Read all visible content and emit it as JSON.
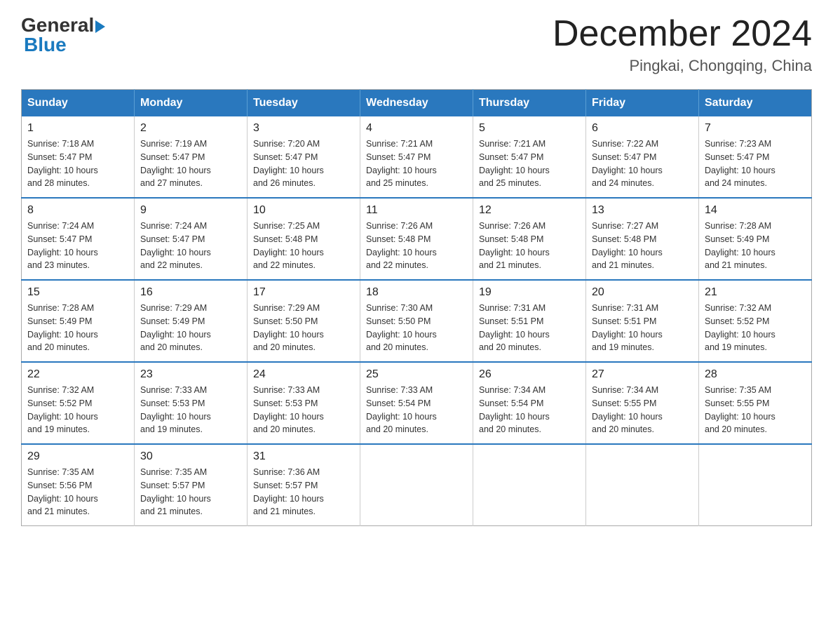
{
  "header": {
    "logo_general": "General",
    "logo_blue": "Blue",
    "title": "December 2024",
    "subtitle": "Pingkai, Chongqing, China"
  },
  "calendar": {
    "weekdays": [
      "Sunday",
      "Monday",
      "Tuesday",
      "Wednesday",
      "Thursday",
      "Friday",
      "Saturday"
    ],
    "weeks": [
      [
        {
          "day": "1",
          "sunrise": "7:18 AM",
          "sunset": "5:47 PM",
          "daylight": "10 hours and 28 minutes."
        },
        {
          "day": "2",
          "sunrise": "7:19 AM",
          "sunset": "5:47 PM",
          "daylight": "10 hours and 27 minutes."
        },
        {
          "day": "3",
          "sunrise": "7:20 AM",
          "sunset": "5:47 PM",
          "daylight": "10 hours and 26 minutes."
        },
        {
          "day": "4",
          "sunrise": "7:21 AM",
          "sunset": "5:47 PM",
          "daylight": "10 hours and 25 minutes."
        },
        {
          "day": "5",
          "sunrise": "7:21 AM",
          "sunset": "5:47 PM",
          "daylight": "10 hours and 25 minutes."
        },
        {
          "day": "6",
          "sunrise": "7:22 AM",
          "sunset": "5:47 PM",
          "daylight": "10 hours and 24 minutes."
        },
        {
          "day": "7",
          "sunrise": "7:23 AM",
          "sunset": "5:47 PM",
          "daylight": "10 hours and 24 minutes."
        }
      ],
      [
        {
          "day": "8",
          "sunrise": "7:24 AM",
          "sunset": "5:47 PM",
          "daylight": "10 hours and 23 minutes."
        },
        {
          "day": "9",
          "sunrise": "7:24 AM",
          "sunset": "5:47 PM",
          "daylight": "10 hours and 22 minutes."
        },
        {
          "day": "10",
          "sunrise": "7:25 AM",
          "sunset": "5:48 PM",
          "daylight": "10 hours and 22 minutes."
        },
        {
          "day": "11",
          "sunrise": "7:26 AM",
          "sunset": "5:48 PM",
          "daylight": "10 hours and 22 minutes."
        },
        {
          "day": "12",
          "sunrise": "7:26 AM",
          "sunset": "5:48 PM",
          "daylight": "10 hours and 21 minutes."
        },
        {
          "day": "13",
          "sunrise": "7:27 AM",
          "sunset": "5:48 PM",
          "daylight": "10 hours and 21 minutes."
        },
        {
          "day": "14",
          "sunrise": "7:28 AM",
          "sunset": "5:49 PM",
          "daylight": "10 hours and 21 minutes."
        }
      ],
      [
        {
          "day": "15",
          "sunrise": "7:28 AM",
          "sunset": "5:49 PM",
          "daylight": "10 hours and 20 minutes."
        },
        {
          "day": "16",
          "sunrise": "7:29 AM",
          "sunset": "5:49 PM",
          "daylight": "10 hours and 20 minutes."
        },
        {
          "day": "17",
          "sunrise": "7:29 AM",
          "sunset": "5:50 PM",
          "daylight": "10 hours and 20 minutes."
        },
        {
          "day": "18",
          "sunrise": "7:30 AM",
          "sunset": "5:50 PM",
          "daylight": "10 hours and 20 minutes."
        },
        {
          "day": "19",
          "sunrise": "7:31 AM",
          "sunset": "5:51 PM",
          "daylight": "10 hours and 20 minutes."
        },
        {
          "day": "20",
          "sunrise": "7:31 AM",
          "sunset": "5:51 PM",
          "daylight": "10 hours and 19 minutes."
        },
        {
          "day": "21",
          "sunrise": "7:32 AM",
          "sunset": "5:52 PM",
          "daylight": "10 hours and 19 minutes."
        }
      ],
      [
        {
          "day": "22",
          "sunrise": "7:32 AM",
          "sunset": "5:52 PM",
          "daylight": "10 hours and 19 minutes."
        },
        {
          "day": "23",
          "sunrise": "7:33 AM",
          "sunset": "5:53 PM",
          "daylight": "10 hours and 19 minutes."
        },
        {
          "day": "24",
          "sunrise": "7:33 AM",
          "sunset": "5:53 PM",
          "daylight": "10 hours and 20 minutes."
        },
        {
          "day": "25",
          "sunrise": "7:33 AM",
          "sunset": "5:54 PM",
          "daylight": "10 hours and 20 minutes."
        },
        {
          "day": "26",
          "sunrise": "7:34 AM",
          "sunset": "5:54 PM",
          "daylight": "10 hours and 20 minutes."
        },
        {
          "day": "27",
          "sunrise": "7:34 AM",
          "sunset": "5:55 PM",
          "daylight": "10 hours and 20 minutes."
        },
        {
          "day": "28",
          "sunrise": "7:35 AM",
          "sunset": "5:55 PM",
          "daylight": "10 hours and 20 minutes."
        }
      ],
      [
        {
          "day": "29",
          "sunrise": "7:35 AM",
          "sunset": "5:56 PM",
          "daylight": "10 hours and 21 minutes."
        },
        {
          "day": "30",
          "sunrise": "7:35 AM",
          "sunset": "5:57 PM",
          "daylight": "10 hours and 21 minutes."
        },
        {
          "day": "31",
          "sunrise": "7:36 AM",
          "sunset": "5:57 PM",
          "daylight": "10 hours and 21 minutes."
        },
        null,
        null,
        null,
        null
      ]
    ],
    "sunrise_label": "Sunrise:",
    "sunset_label": "Sunset:",
    "daylight_label": "Daylight:"
  }
}
